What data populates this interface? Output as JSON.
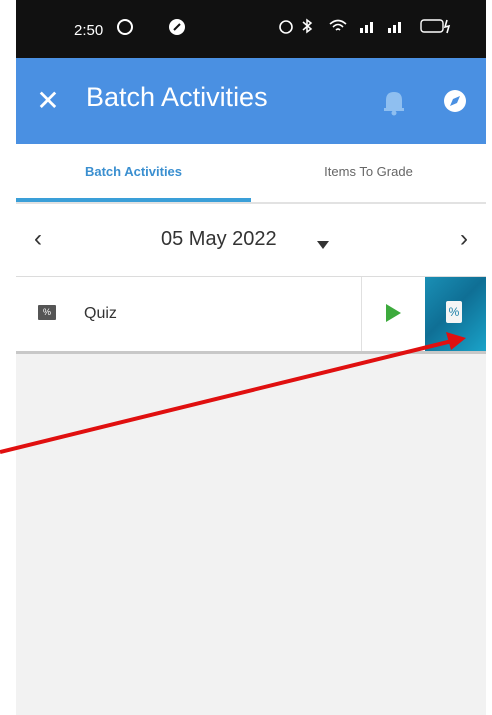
{
  "status_bar": {
    "time": "2:50",
    "battery": "38"
  },
  "app_bar": {
    "close_glyph": "✕",
    "title": "Batch Activities"
  },
  "tabs": [
    {
      "label": "Batch Activities",
      "active": true
    },
    {
      "label": "Items To Grade",
      "active": false
    }
  ],
  "date_nav": {
    "prev_glyph": "‹",
    "date": "05 May 2022",
    "next_glyph": "›"
  },
  "activities": [
    {
      "badge": "%",
      "label": "Quiz",
      "tile_glyph": "%"
    }
  ],
  "colors": {
    "app_bar": "#4a90e2",
    "tab_active": "#3a8fd0",
    "play": "#3daa3d",
    "annotation_arrow": "#e01010"
  },
  "icons": [
    "whatsapp-icon",
    "app-icon",
    "alarm-icon",
    "bluetooth-icon",
    "wifi-icon",
    "signal-icon",
    "battery-icon",
    "bell-icon",
    "compass-icon",
    "dropdown-caret-icon",
    "play-icon"
  ]
}
